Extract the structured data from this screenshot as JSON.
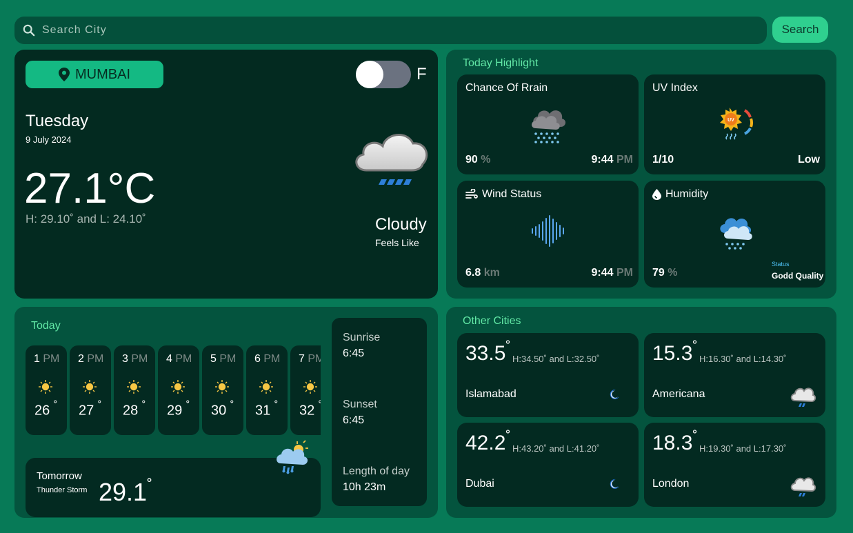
{
  "search": {
    "placeholder": "Search City",
    "button_label": "Search"
  },
  "location": {
    "city": "MUMBAI"
  },
  "unit_toggle": {
    "label": "F"
  },
  "current": {
    "day": "Tuesday",
    "date": "9 July 2024",
    "temperature": "27.1°C",
    "high_low": "H: 29.10˚ and L: 24.10˚",
    "condition": "Cloudy",
    "feels_like_label": "Feels Like"
  },
  "highlight": {
    "title": "Today Highlight",
    "rain": {
      "title": "Chance Of Rrain",
      "value": "90",
      "unit": "%",
      "time": "9:44",
      "ampm": "PM"
    },
    "uv": {
      "title": "UV Index",
      "value": "1/10",
      "level": "Low"
    },
    "wind": {
      "title": "Wind Status",
      "value": "6.8",
      "unit": "km",
      "time": "9:44",
      "ampm": "PM"
    },
    "humidity": {
      "title": "Humidity",
      "value": "79",
      "unit": "%",
      "status_label": "Status",
      "status": "Godd Quality"
    }
  },
  "today": {
    "title": "Today",
    "hours": [
      {
        "hour": "1",
        "ampm": "PM",
        "temp": "26",
        "deg": "˚"
      },
      {
        "hour": "2",
        "ampm": "PM",
        "temp": "27",
        "deg": "˚"
      },
      {
        "hour": "3",
        "ampm": "PM",
        "temp": "28",
        "deg": "˚"
      },
      {
        "hour": "4",
        "ampm": "PM",
        "temp": "29",
        "deg": "˚"
      },
      {
        "hour": "5",
        "ampm": "PM",
        "temp": "30",
        "deg": "˚"
      },
      {
        "hour": "6",
        "ampm": "PM",
        "temp": "31",
        "deg": "˚"
      },
      {
        "hour": "7",
        "ampm": "PM",
        "temp": "32",
        "deg": "˚"
      }
    ],
    "tomorrow": {
      "label": "Tomorrow",
      "condition": "Thunder Storm",
      "temp": "29.1",
      "deg": "˚"
    },
    "sun": {
      "sunrise_label": "Sunrise",
      "sunrise": "6:45",
      "sunset_label": "Sunset",
      "sunset": "6:45",
      "length_label": "Length of day",
      "length": "10h 23m"
    }
  },
  "other_cities": {
    "title": "Other Cities",
    "items": [
      {
        "temp": "33.5",
        "deg": "˚",
        "hilo": "H:34.50˚ and L:32.50˚",
        "name": "Islamabad",
        "icon": "moon-icon"
      },
      {
        "temp": "15.3",
        "deg": "˚",
        "hilo": "H:16.30˚ and L:14.30˚",
        "name": "Americana",
        "icon": "rain-cloud-icon"
      },
      {
        "temp": "42.2",
        "deg": "˚",
        "hilo": "H:43.20˚ and L:41.20˚",
        "name": "Dubai",
        "icon": "moon-icon"
      },
      {
        "temp": "18.3",
        "deg": "˚",
        "hilo": "H:19.30˚ and L:17.30˚",
        "name": "London",
        "icon": "rain-cloud-icon"
      }
    ]
  },
  "colors": {
    "background": "#077a57",
    "panel": "#04543e",
    "card": "#032a21",
    "accent": "#14b983",
    "title_green": "#62e8a6"
  }
}
